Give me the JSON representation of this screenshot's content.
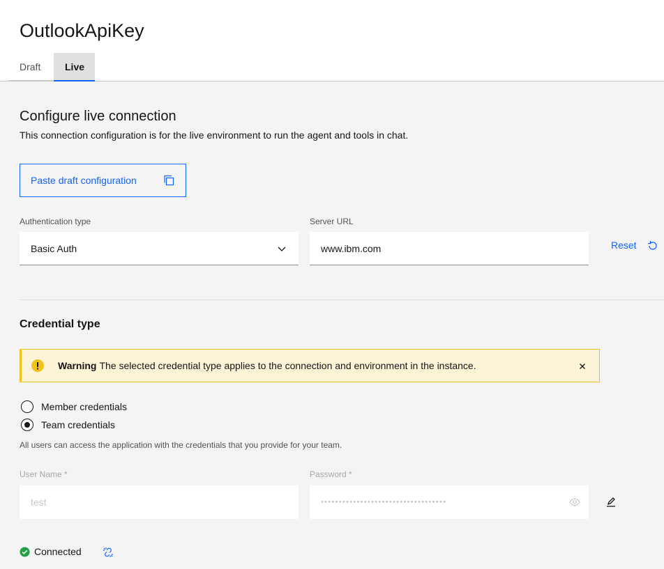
{
  "header": {
    "title": "OutlookApiKey",
    "tabs": [
      {
        "label": "Draft"
      },
      {
        "label": "Live"
      }
    ]
  },
  "section": {
    "title": "Configure live connection",
    "description": "This connection configuration is for the live environment to run the agent and tools in chat."
  },
  "paste_button": {
    "label": "Paste draft configuration",
    "icon": "copy-icon"
  },
  "auth": {
    "label": "Authentication type",
    "value": "Basic Auth"
  },
  "server": {
    "label": "Server URL",
    "value": "www.ibm.com"
  },
  "reset": {
    "label": "Reset",
    "icon": "reset-icon"
  },
  "credential": {
    "title": "Credential type",
    "warning_title": "Warning",
    "warning_text": "The selected credential type applies to the connection and environment in the instance.",
    "options": [
      {
        "label": "Member credentials",
        "selected": false
      },
      {
        "label": "Team credentials",
        "selected": true
      }
    ],
    "helper": "All users can access the application with the credentials that you provide for your team.",
    "username_label": "User Name *",
    "username_value": "test",
    "password_label": "Password *",
    "password_value": "•••••••••••••••••••••••••••••••••••"
  },
  "status": {
    "label": "Connected"
  },
  "colors": {
    "accent": "#0f62fe",
    "warning_bg": "#fcf4d6",
    "warning_border": "#f1c21b",
    "success": "#24a148",
    "background": "#f4f4f4"
  }
}
